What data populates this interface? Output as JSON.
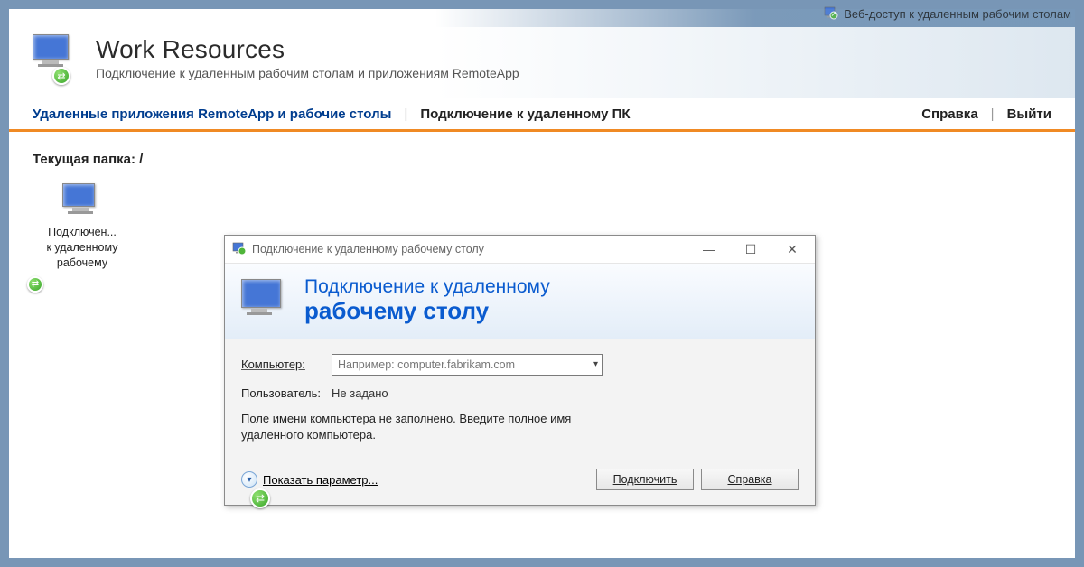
{
  "topbar": {
    "label": "Веб-доступ к удаленным рабочим столам"
  },
  "header": {
    "title": "Work Resources",
    "subtitle": "Подключение к удаленным рабочим столам и приложениям RemoteApp"
  },
  "nav": {
    "remoteapps": "Удаленные приложения RemoteApp и рабочие столы",
    "connect_pc": "Подключение к удаленному ПК",
    "help": "Справка",
    "signout": "Выйти"
  },
  "content": {
    "folder_label": "Текущая папка: /",
    "app_item": {
      "line1": "Подключен...",
      "line2": "к удаленному",
      "line3": "рабочему"
    }
  },
  "dialog": {
    "window_title": "Подключение к удаленному рабочему столу",
    "title_line1": "Подключение к удаленному",
    "title_line2": "рабочему столу",
    "computer_label": "Компьютер:",
    "computer_placeholder": "Например: computer.fabrikam.com",
    "user_label": "Пользователь:",
    "user_value": "Не задано",
    "hint": "Поле имени компьютера не заполнено. Введите полное имя удаленного компьютера.",
    "show_options": "Показать параметр...",
    "connect": "Подключить",
    "help": "Справка"
  }
}
